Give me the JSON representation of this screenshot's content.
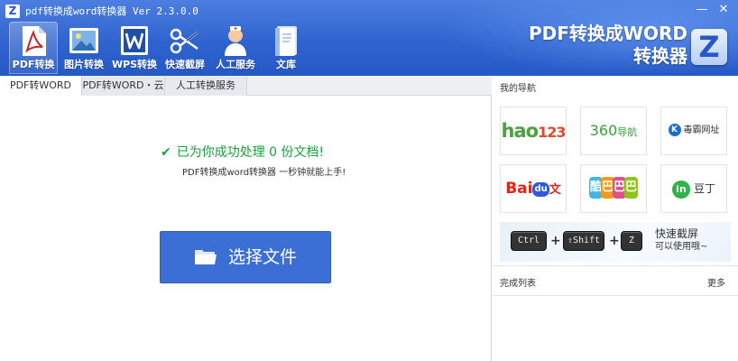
{
  "window": {
    "logo_char": "Z",
    "title": "pdf转换成word转换器 Ver 2.3.0.0",
    "minimize_label": "—",
    "close_label": "✕"
  },
  "toolbar": {
    "items": [
      {
        "label": "PDF转换",
        "icon": "pdf-icon"
      },
      {
        "label": "图片转换",
        "icon": "image-icon"
      },
      {
        "label": "WPS转换",
        "icon": "wps-icon"
      },
      {
        "label": "快速截屏",
        "icon": "scissors-icon"
      },
      {
        "label": "人工服务",
        "icon": "support-agent-icon"
      },
      {
        "label": "文库",
        "icon": "book-icon"
      }
    ]
  },
  "brand": {
    "line1": "PDF转换成WORD",
    "line2": "转换器",
    "badge": "Z"
  },
  "tabs": [
    {
      "label": "PDF转WORD"
    },
    {
      "label": "PDF转WORD・云"
    },
    {
      "label": "人工转换服务"
    }
  ],
  "main": {
    "success_message": "已为你成功处理 0 份文档!",
    "sub_message": "PDF转换成word转换器 一秒钟就能上手!",
    "choose_button": "选择文件"
  },
  "sidebar": {
    "title": "我的导航",
    "links": [
      {
        "name": "hao123",
        "part1": "hao",
        "part2": "123"
      },
      {
        "name": "360导航",
        "part1": "360",
        "part2": "导航"
      },
      {
        "name": "毒霸网址",
        "part1": "K",
        "part2": "毒霸网址"
      },
      {
        "name": "百度文库",
        "part1": "Bai",
        "part2": "du",
        "part3": "文库"
      },
      {
        "name": "酷巴巴",
        "chars": [
          "酷",
          "巴",
          "巴",
          "巴"
        ]
      },
      {
        "name": "豆丁",
        "part1": "in",
        "part2": "豆丁"
      }
    ],
    "shortcut": {
      "key1": "Ctrl",
      "key2": "⇧Shift",
      "key3": "Z",
      "plus": "+",
      "line1": "快速截屏",
      "line2": "可以使用哦~"
    },
    "done_title": "完成列表",
    "more": "更多"
  }
}
